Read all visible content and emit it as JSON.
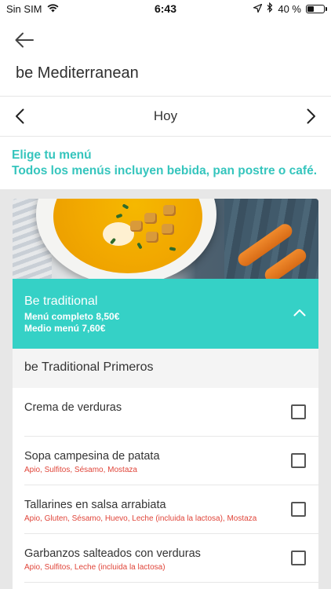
{
  "status": {
    "carrier": "Sin SIM",
    "time": "6:43",
    "battery": "40 %",
    "battery_level": 0.4
  },
  "header": {
    "title": "be Mediterranean"
  },
  "date_nav": {
    "label": "Hoy"
  },
  "info": {
    "line1": "Elige tu menú",
    "line2": "Todos los menús incluyen bebida, pan postre o café."
  },
  "menu": {
    "title": "Be traditional",
    "price_full": "Menú completo 8,50€",
    "price_half": "Medio menú 7,60€"
  },
  "section": {
    "title": "be Traditional Primeros"
  },
  "items": [
    {
      "name": "Crema de verduras",
      "allergens": ""
    },
    {
      "name": "Sopa campesina de patata",
      "allergens": "Apio, Sulfitos, Sésamo, Mostaza"
    },
    {
      "name": "Tallarines en salsa arrabiata",
      "allergens": "Apio, Gluten, Sésamo, Huevo, Leche (incluida la lactosa), Mostaza"
    },
    {
      "name": "Garbanzos salteados con verduras",
      "allergens": "Apio, Sulfitos, Leche (incluida la lactosa)"
    }
  ],
  "colors": {
    "accent": "#35d1c6",
    "info_text": "#35c5bd",
    "allergen": "#e0453a"
  }
}
